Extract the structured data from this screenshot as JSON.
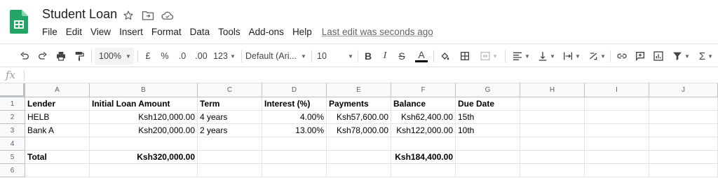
{
  "app": {
    "title": "Student Loan",
    "menu": [
      "File",
      "Edit",
      "View",
      "Insert",
      "Format",
      "Data",
      "Tools",
      "Add-ons",
      "Help"
    ],
    "last_edit": "Last edit was seconds ago"
  },
  "toolbar": {
    "zoom": "100%",
    "currency_symbol": "£",
    "percent_symbol": "%",
    "decrease_decimal": ".0",
    "increase_decimal": ".00",
    "more_formats": "123",
    "font_family": "Default (Ari...",
    "font_size": "10",
    "bold_label": "B",
    "italic_label": "I",
    "strike_label": "S",
    "text_color_label": "A",
    "text_color": "#000000",
    "function_label": "Σ"
  },
  "formula_bar": {
    "fx_label": "fx",
    "value": ""
  },
  "sheet": {
    "columns": [
      "A",
      "B",
      "C",
      "D",
      "E",
      "F",
      "G",
      "H",
      "I",
      "J"
    ],
    "row_numbers": [
      "1",
      "2",
      "3",
      "4",
      "5",
      "6"
    ],
    "rows": [
      [
        "Lender",
        "Initial Loan Amount",
        "Term",
        "Interest (%)",
        "Payments",
        "Balance",
        "Due Date",
        "",
        "",
        ""
      ],
      [
        "HELB",
        "Ksh120,000.00",
        "4 years",
        "4.00%",
        "Ksh57,600.00",
        "Ksh62,400.00",
        "15th",
        "",
        "",
        ""
      ],
      [
        "Bank A",
        "Ksh200,000.00",
        "2 years",
        "13.00%",
        "Ksh78,000.00",
        "Ksh122,000.00",
        "10th",
        "",
        "",
        ""
      ],
      [
        "",
        "",
        "",
        "",
        "",
        "",
        "",
        "",
        "",
        ""
      ],
      [
        "Total",
        "Ksh320,000.00",
        "",
        "",
        "",
        "Ksh184,400.00",
        "",
        "",
        "",
        ""
      ],
      [
        "",
        "",
        "",
        "",
        "",
        "",
        "",
        "",
        "",
        ""
      ]
    ]
  },
  "colors": {
    "brand_green": "#23A566",
    "header_bg": "#f8f9fa",
    "grid_line": "#e2e3e3"
  }
}
